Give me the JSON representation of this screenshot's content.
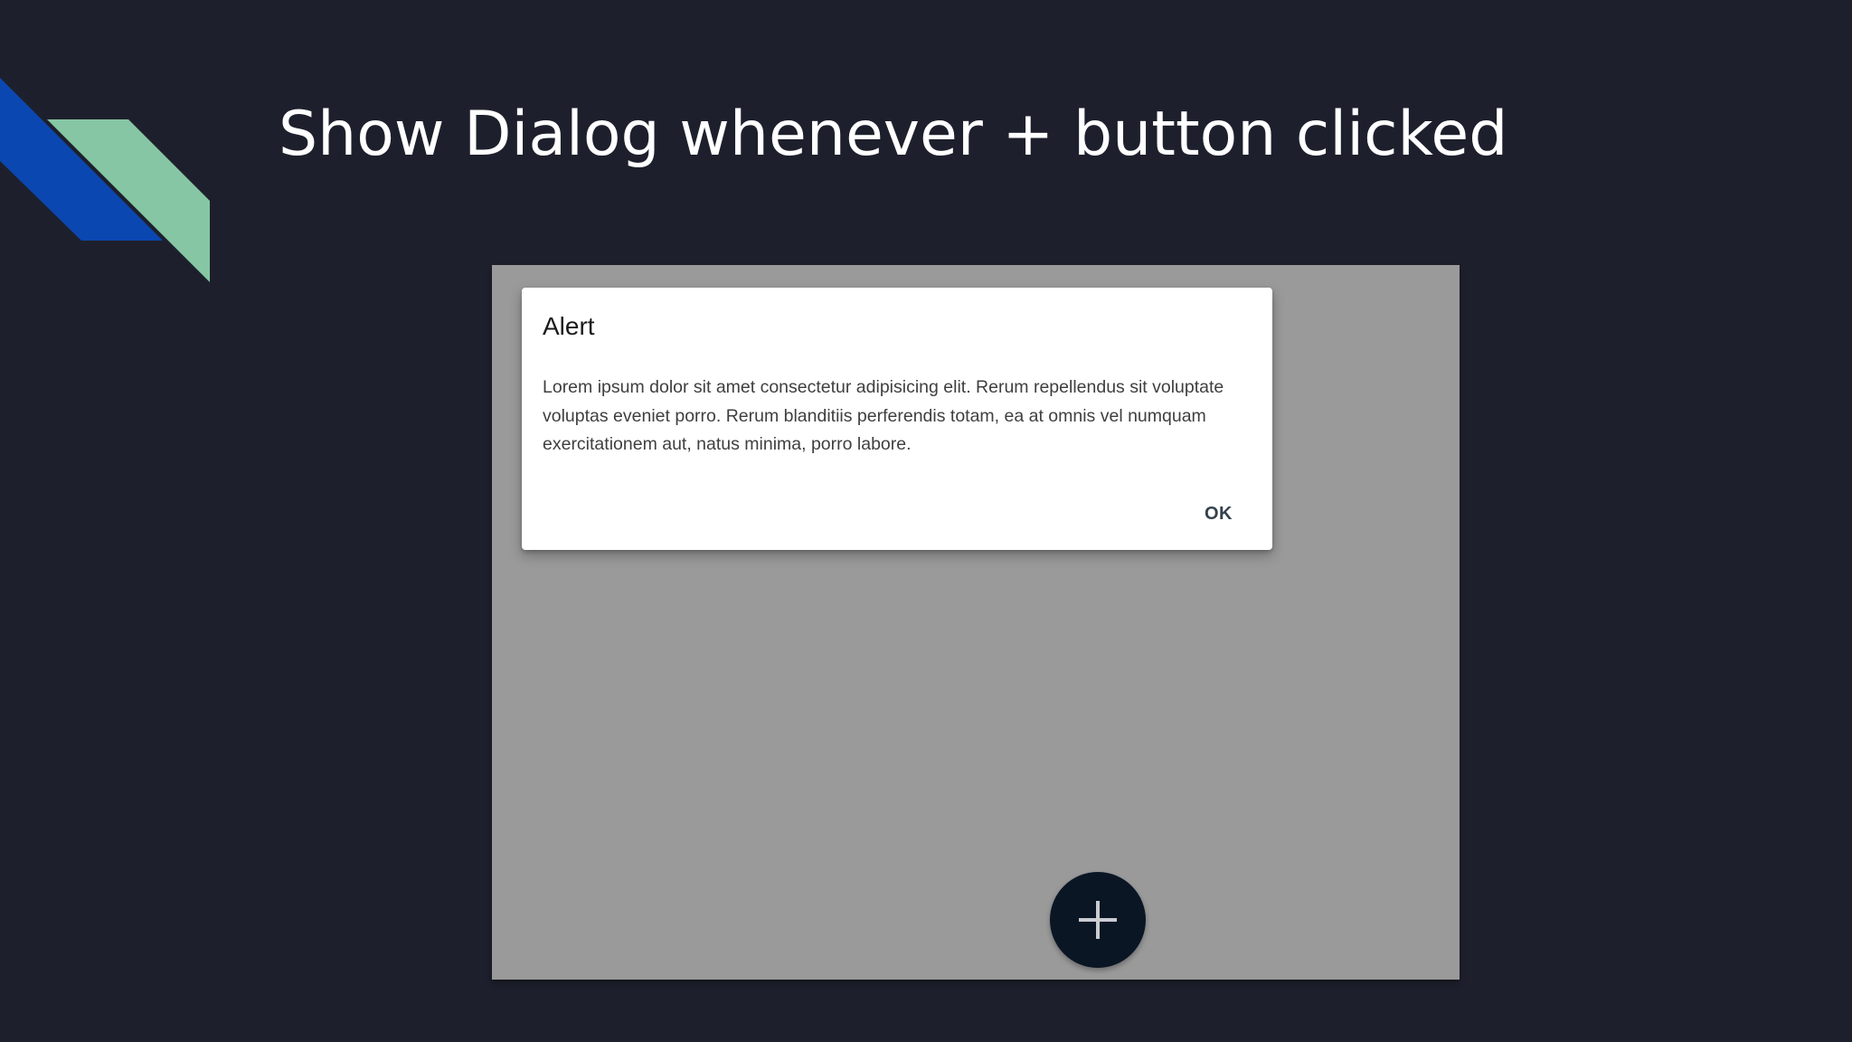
{
  "slide": {
    "title": "Show Dialog whenever + button clicked"
  },
  "colors": {
    "background": "#1d202c",
    "accent_blue": "#0b47b0",
    "accent_green": "#86c6a4",
    "screen_overlay": "#9a9a9a",
    "fab": "#0b1625"
  },
  "dialog": {
    "title": "Alert",
    "body": "Lorem ipsum dolor sit amet consectetur adipisicing elit. Rerum repellendus sit voluptate voluptas eveniet porro. Rerum blanditiis perferendis totam, ea at omnis vel numquam exercitationem aut, natus minima, porro labore.",
    "ok_label": "OK"
  },
  "fab": {
    "icon": "plus-icon"
  }
}
